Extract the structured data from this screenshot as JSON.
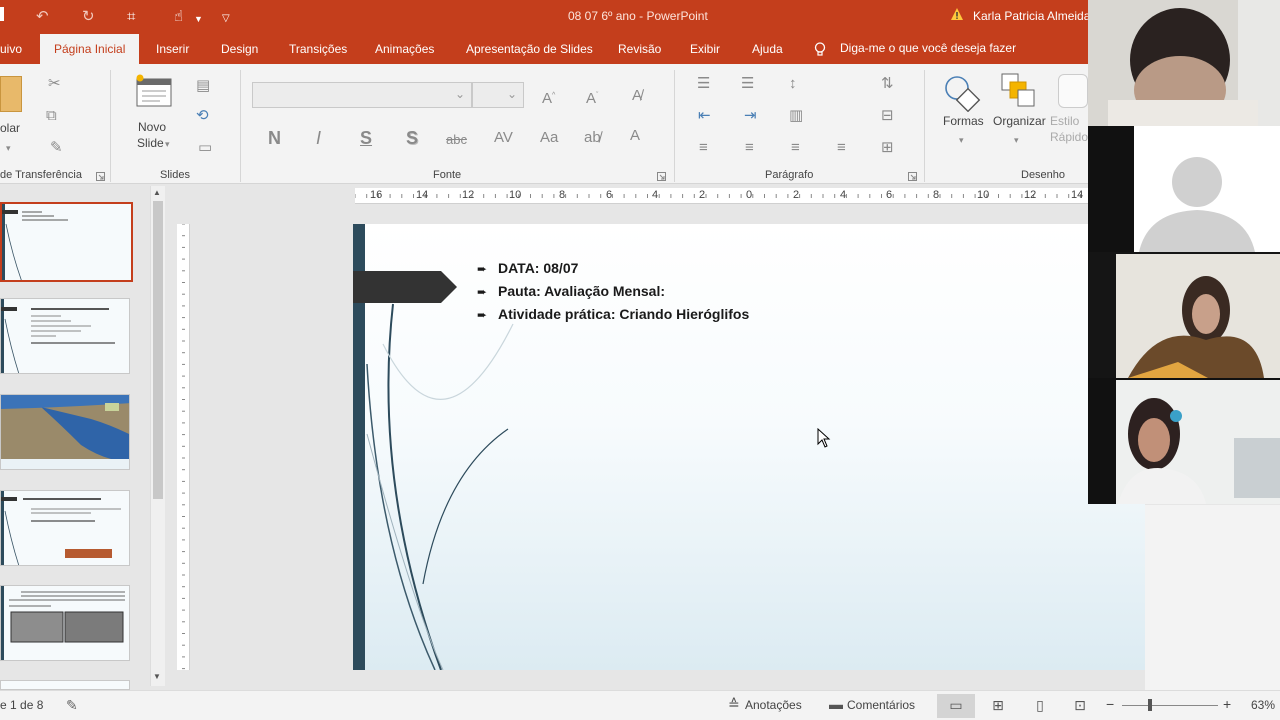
{
  "titlebar": {
    "document_title": "08 07 6º ano  -  PowerPoint",
    "user_name": "Karla Patricia Almeida"
  },
  "tabs": {
    "file_partial": "uivo",
    "items": [
      "Página Inicial",
      "Inserir",
      "Design",
      "Transições",
      "Animações",
      "Apresentação de Slides",
      "Revisão",
      "Exibir",
      "Ajuda"
    ],
    "tell_me": "Diga-me o que você deseja fazer"
  },
  "ribbon": {
    "clipboard": {
      "paste_label": "olar",
      "group_label": "de Transferência"
    },
    "slides": {
      "new_slide_line1": "Novo",
      "new_slide_line2": "Slide",
      "group_label": "Slides"
    },
    "font": {
      "group_label": "Fonte",
      "bold": "N",
      "italic": "I",
      "underline": "S",
      "shadow": "S",
      "strike": "abc",
      "spacing": "AV",
      "case": "Aa"
    },
    "paragraph": {
      "group_label": "Parágrafo"
    },
    "drawing": {
      "shapes_label": "Formas",
      "arrange_label": "Organizar",
      "styles_line1": "Estilo",
      "styles_line2": "Rápido",
      "group_label": "Desenho"
    }
  },
  "ruler": {
    "labels": [
      "16",
      "14",
      "12",
      "10",
      "8",
      "6",
      "4",
      "2",
      "0",
      "2",
      "4",
      "6",
      "8",
      "10",
      "12",
      "14"
    ]
  },
  "slide": {
    "bullets": [
      "DATA: 08/07",
      "Pauta: Avaliação Mensal:",
      "Atividade prática: Criando Hieróglifos"
    ],
    "accent_color": "#2d4b5c"
  },
  "statusbar": {
    "slide_counter": "e 1 de 8",
    "notes": "Anotações",
    "comments": "Comentários",
    "zoom": "63%"
  },
  "colors": {
    "brand": "#c43e1c",
    "ribbon_bg": "#f3f3f3"
  }
}
